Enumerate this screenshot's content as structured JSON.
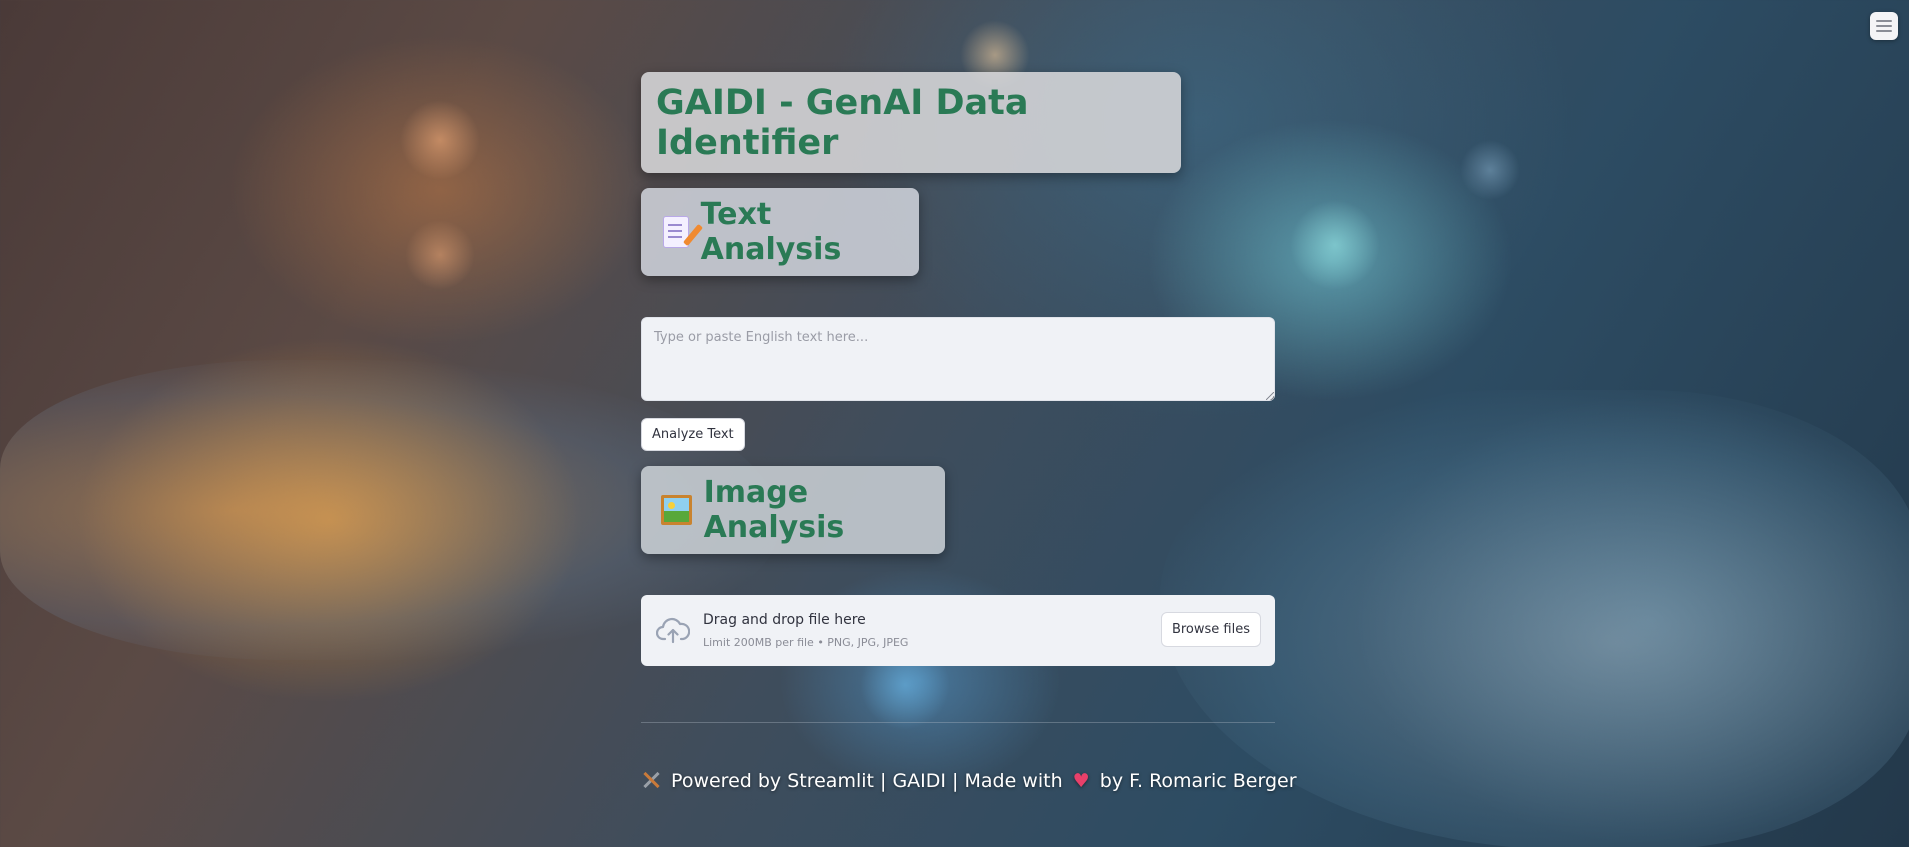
{
  "header": {
    "title": "GAIDI - GenAI Data Identifier"
  },
  "text_section": {
    "heading": "Text Analysis",
    "heading_icon": "memo-icon",
    "placeholder": "Type or paste English text here...",
    "button_label": "Analyze Text"
  },
  "image_section": {
    "heading": "Image Analysis",
    "heading_icon": "framed-picture-icon",
    "uploader": {
      "drop_label": "Drag and drop file here",
      "limit_label": "Limit 200MB per file • PNG, JPG, JPEG",
      "browse_label": "Browse files",
      "icon": "cloud-upload-icon"
    }
  },
  "footer": {
    "powered": "Powered by Streamlit | GAIDI | Made with",
    "author": "by F. Romaric Berger",
    "icons": [
      "tools-icon",
      "heart-icon"
    ]
  },
  "menu": {
    "icon": "hamburger-menu-icon"
  },
  "colors": {
    "accent_green": "#2a7a55",
    "panel_bg": "#d7d7da",
    "input_bg": "#f0f2f6"
  }
}
